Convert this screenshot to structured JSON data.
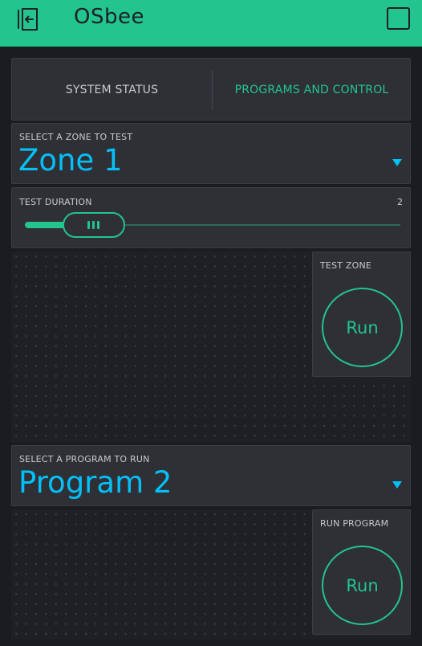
{
  "header": {
    "title": "OSbee",
    "accent": "#23c48e",
    "left_icon": "exit-icon",
    "right_icon": "square-icon"
  },
  "tabs": [
    {
      "label": "SYSTEM STATUS",
      "active": false
    },
    {
      "label": "PROGRAMS AND CONTROL",
      "active": true
    }
  ],
  "zone_select": {
    "label": "SELECT A ZONE TO TEST",
    "value": "Zone 1",
    "value_color": "#04c0f8"
  },
  "test_duration": {
    "label": "TEST DURATION",
    "value": "2",
    "fraction": 0.12
  },
  "test_zone": {
    "label": "TEST ZONE",
    "button": "Run"
  },
  "program_select": {
    "label": "SELECT A PROGRAM TO RUN",
    "value": "Program 2"
  },
  "run_program": {
    "label": "RUN PROGRAM",
    "button": "Run"
  }
}
